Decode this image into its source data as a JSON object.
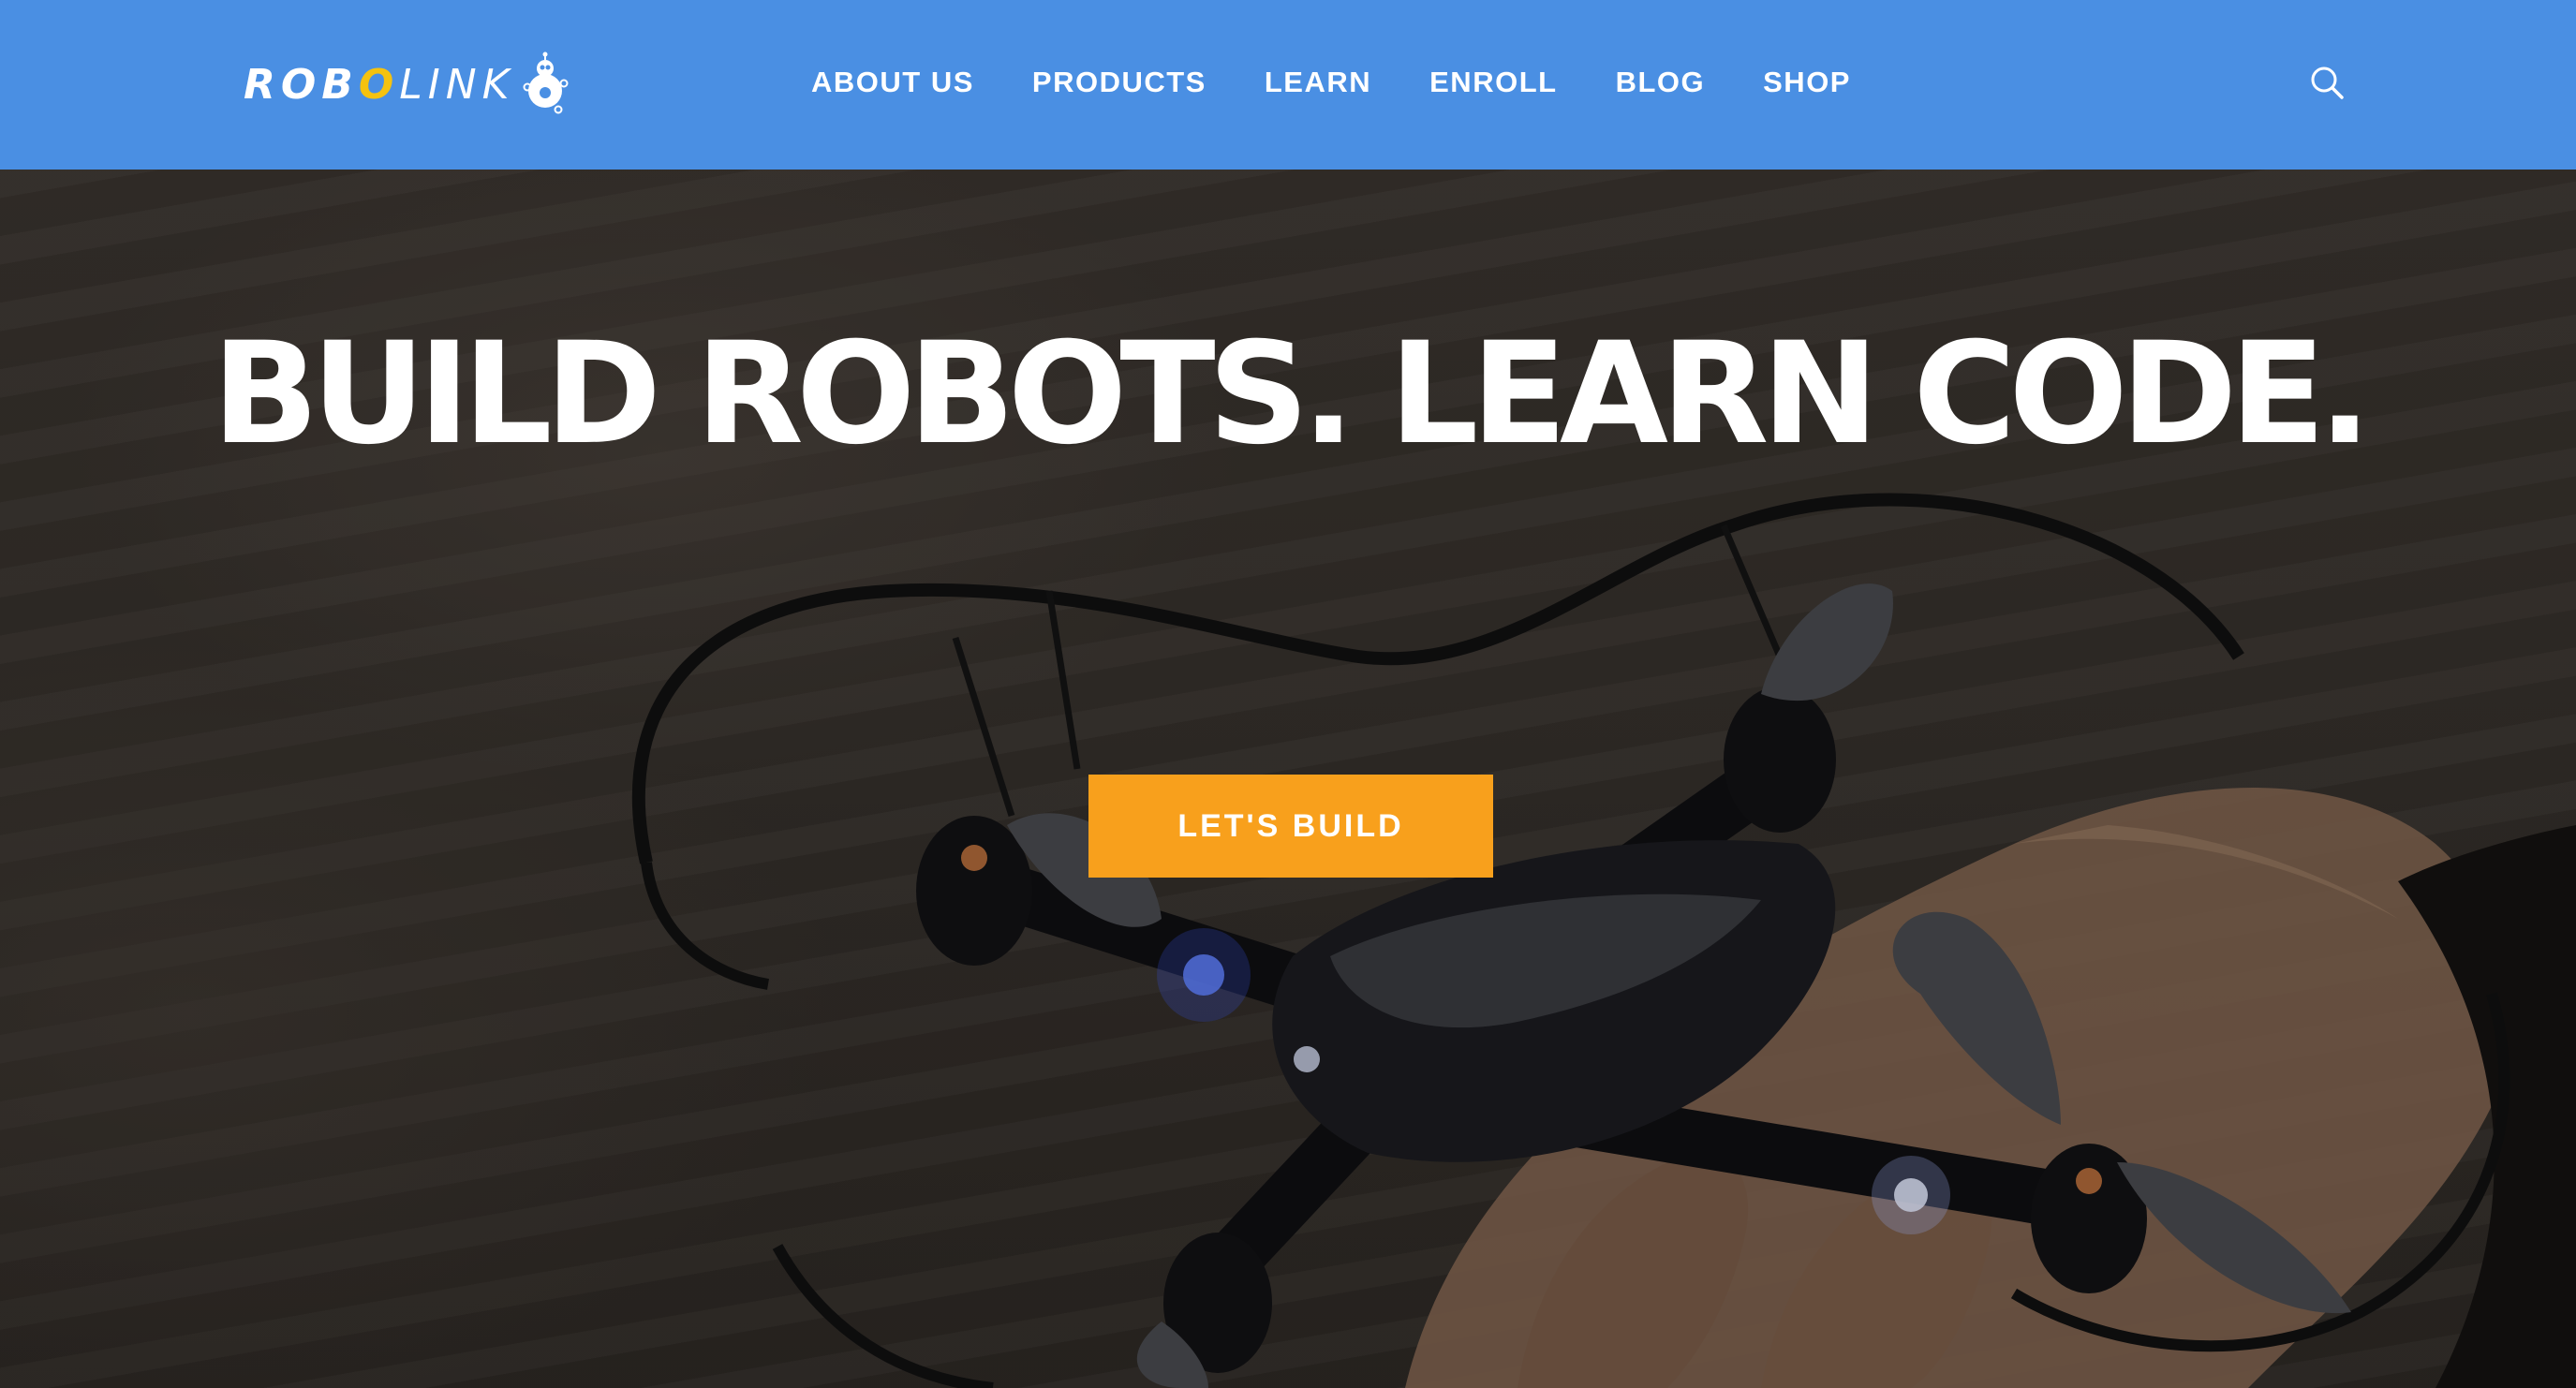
{
  "header": {
    "logo": {
      "text_bold": "ROBO",
      "text_accent": "O",
      "text_light": "LINK",
      "alt": "ROBOLINK"
    },
    "nav": [
      {
        "label": "ABOUT US"
      },
      {
        "label": "PRODUCTS"
      },
      {
        "label": "LEARN"
      },
      {
        "label": "ENROLL"
      },
      {
        "label": "BLOG"
      },
      {
        "label": "SHOP"
      }
    ],
    "search_icon": "search-icon",
    "background_color": "#4a8fe3"
  },
  "hero": {
    "title": "BUILD ROBOTS. LEARN CODE.",
    "cta_label": "LET'S BUILD",
    "cta_color": "#f8a01c",
    "image": "drone-in-hand"
  }
}
